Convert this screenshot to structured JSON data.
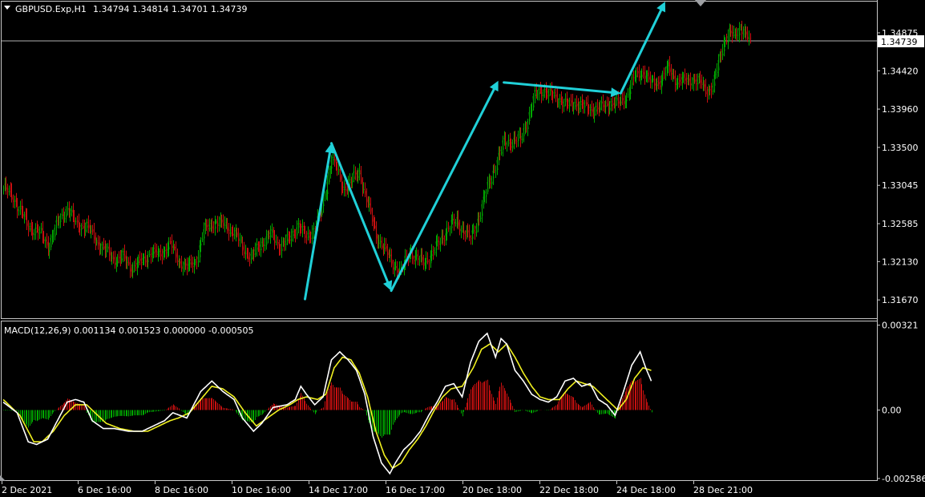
{
  "header": {
    "symbol": "GBPUSD.Exp,H1",
    "ohlc": "1.34794 1.34814 1.34701 1.34739"
  },
  "macd_header": {
    "label": "MACD(12,26,9) 0.001134 0.001523 0.000000 -0.000505"
  },
  "current_price": "1.34739",
  "colors": {
    "bull": "#00a800",
    "bear": "#c81010",
    "arrow": "#20d0d8",
    "macd_line": "#ffffff",
    "signal_line": "#f0f020",
    "grid_line": "#c0c0c0"
  },
  "chart_data": [
    {
      "type": "candlestick",
      "title": "GBPUSD.Exp,H1",
      "ylim": [
        1.3145,
        1.3525
      ],
      "y_ticks": [
        "1.34875",
        "1.34420",
        "1.33960",
        "1.33500",
        "1.33045",
        "1.32585",
        "1.32130",
        "1.31670"
      ],
      "x_ticks": [
        "2 Dec 2021",
        "6 Dec 16:00",
        "8 Dec 16:00",
        "10 Dec 16:00",
        "14 Dec 17:00",
        "16 Dec 17:00",
        "20 Dec 18:00",
        "22 Dec 18:00",
        "24 Dec 18:00",
        "28 Dec 21:00"
      ],
      "close_anchors": [
        [
          0,
          1.3302
        ],
        [
          6,
          1.3292
        ],
        [
          12,
          1.3275
        ],
        [
          18,
          1.3255
        ],
        [
          26,
          1.3248
        ],
        [
          32,
          1.3232
        ],
        [
          40,
          1.3262
        ],
        [
          46,
          1.3278
        ],
        [
          52,
          1.3258
        ],
        [
          60,
          1.3255
        ],
        [
          66,
          1.324
        ],
        [
          72,
          1.3228
        ],
        [
          80,
          1.3216
        ],
        [
          86,
          1.3218
        ],
        [
          92,
          1.3206
        ],
        [
          100,
          1.3214
        ],
        [
          106,
          1.3224
        ],
        [
          112,
          1.3221
        ],
        [
          120,
          1.3234
        ],
        [
          126,
          1.3214
        ],
        [
          132,
          1.3206
        ],
        [
          138,
          1.3212
        ],
        [
          144,
          1.325
        ],
        [
          152,
          1.3261
        ],
        [
          160,
          1.3256
        ],
        [
          166,
          1.3248
        ],
        [
          172,
          1.323
        ],
        [
          178,
          1.3218
        ],
        [
          186,
          1.3236
        ],
        [
          192,
          1.3246
        ],
        [
          198,
          1.3232
        ],
        [
          206,
          1.324
        ],
        [
          212,
          1.3258
        ],
        [
          218,
          1.324
        ],
        [
          224,
          1.3255
        ],
        [
          228,
          1.327
        ],
        [
          232,
          1.33
        ],
        [
          236,
          1.334
        ],
        [
          240,
          1.3322
        ],
        [
          244,
          1.33
        ],
        [
          250,
          1.331
        ],
        [
          256,
          1.332
        ],
        [
          262,
          1.3282
        ],
        [
          268,
          1.3245
        ],
        [
          274,
          1.3228
        ],
        [
          280,
          1.321
        ],
        [
          286,
          1.32
        ],
        [
          292,
          1.3226
        ],
        [
          296,
          1.3218
        ],
        [
          302,
          1.3212
        ],
        [
          308,
          1.3222
        ],
        [
          314,
          1.3238
        ],
        [
          320,
          1.3254
        ],
        [
          326,
          1.3262
        ],
        [
          330,
          1.3252
        ],
        [
          336,
          1.324
        ],
        [
          342,
          1.3268
        ],
        [
          348,
          1.3302
        ],
        [
          354,
          1.333
        ],
        [
          360,
          1.3356
        ],
        [
          366,
          1.3358
        ],
        [
          372,
          1.336
        ],
        [
          378,
          1.339
        ],
        [
          382,
          1.3412
        ],
        [
          388,
          1.342
        ],
        [
          394,
          1.3412
        ],
        [
          400,
          1.3408
        ],
        [
          406,
          1.34
        ],
        [
          412,
          1.3404
        ],
        [
          418,
          1.3398
        ],
        [
          424,
          1.3396
        ],
        [
          430,
          1.3398
        ],
        [
          436,
          1.3404
        ],
        [
          442,
          1.3402
        ],
        [
          448,
          1.3412
        ],
        [
          454,
          1.3435
        ],
        [
          460,
          1.3442
        ],
        [
          466,
          1.3426
        ],
        [
          472,
          1.343
        ],
        [
          478,
          1.3445
        ],
        [
          484,
          1.343
        ],
        [
          490,
          1.343
        ],
        [
          496,
          1.3432
        ],
        [
          502,
          1.3426
        ],
        [
          506,
          1.3418
        ],
        [
          510,
          1.3424
        ],
        [
          514,
          1.345
        ],
        [
          518,
          1.3478
        ],
        [
          522,
          1.3488
        ],
        [
          526,
          1.3482
        ],
        [
          530,
          1.3496
        ],
        [
          534,
          1.3486
        ],
        [
          537,
          1.3474
        ]
      ],
      "annotation_arrows": [
        [
          [
            217,
            1.3168
          ],
          [
            236,
            1.3355
          ]
        ],
        [
          [
            236,
            1.3355
          ],
          [
            279,
            1.3178
          ]
        ],
        [
          [
            279,
            1.3178
          ],
          [
            356,
            1.343
          ]
        ],
        [
          [
            360,
            1.3428
          ],
          [
            444,
            1.3415
          ]
        ],
        [
          [
            444,
            1.3415
          ],
          [
            476,
            1.3525
          ]
        ]
      ]
    },
    {
      "type": "macd",
      "title": "MACD(12,26,9) 0.001134 0.001523 0.000000 -0.000505",
      "ylim": [
        -0.00265,
        0.00335
      ],
      "y_ticks": [
        "0.00321",
        "0.00",
        "-0.002586"
      ],
      "macd_anchors": [
        [
          0,
          0.0003
        ],
        [
          10,
          -0.0001
        ],
        [
          18,
          -0.0012
        ],
        [
          24,
          -0.0013
        ],
        [
          32,
          -0.0011
        ],
        [
          40,
          -0.0003
        ],
        [
          46,
          0.0003
        ],
        [
          52,
          0.0004
        ],
        [
          58,
          0.0003
        ],
        [
          64,
          -0.0004
        ],
        [
          72,
          -0.0007
        ],
        [
          80,
          -0.0007
        ],
        [
          90,
          -0.0008
        ],
        [
          100,
          -0.0008
        ],
        [
          108,
          -0.0006
        ],
        [
          116,
          -0.0004
        ],
        [
          122,
          -0.0001
        ],
        [
          132,
          -0.0003
        ],
        [
          142,
          0.0007
        ],
        [
          150,
          0.0011
        ],
        [
          158,
          0.0007
        ],
        [
          166,
          0.0004
        ],
        [
          172,
          -0.0003
        ],
        [
          180,
          -0.0008
        ],
        [
          186,
          -0.0005
        ],
        [
          194,
          0.0001
        ],
        [
          204,
          0.0002
        ],
        [
          210,
          0.0004
        ],
        [
          214,
          0.0009
        ],
        [
          218,
          0.0006
        ],
        [
          224,
          0.0002
        ],
        [
          230,
          0.0005
        ],
        [
          236,
          0.0019
        ],
        [
          242,
          0.0022
        ],
        [
          248,
          0.0019
        ],
        [
          254,
          0.0015
        ],
        [
          260,
          0.0006
        ],
        [
          266,
          -0.001
        ],
        [
          272,
          -0.002
        ],
        [
          278,
          -0.0024
        ],
        [
          282,
          -0.002
        ],
        [
          288,
          -0.0015
        ],
        [
          294,
          -0.0012
        ],
        [
          300,
          -0.0008
        ],
        [
          306,
          -0.0002
        ],
        [
          312,
          0.0003
        ],
        [
          318,
          0.0009
        ],
        [
          324,
          0.001
        ],
        [
          330,
          0.0005
        ],
        [
          336,
          0.0018
        ],
        [
          342,
          0.0026
        ],
        [
          348,
          0.0029
        ],
        [
          354,
          0.002
        ],
        [
          358,
          0.0027
        ],
        [
          362,
          0.0025
        ],
        [
          368,
          0.0015
        ],
        [
          374,
          0.0011
        ],
        [
          380,
          0.0006
        ],
        [
          386,
          0.0004
        ],
        [
          392,
          0.0003
        ],
        [
          398,
          0.0005
        ],
        [
          404,
          0.0011
        ],
        [
          410,
          0.0012
        ],
        [
          416,
          0.0009
        ],
        [
          422,
          0.001
        ],
        [
          428,
          0.0004
        ],
        [
          434,
          0.0002
        ],
        [
          440,
          -0.0002
        ],
        [
          446,
          0.0007
        ],
        [
          452,
          0.0017
        ],
        [
          458,
          0.0022
        ],
        [
          462,
          0.0016
        ],
        [
          466,
          0.0011
        ]
      ],
      "signal_anchors": [
        [
          0,
          0.0004
        ],
        [
          12,
          -0.0002
        ],
        [
          22,
          -0.0012
        ],
        [
          28,
          -0.0012
        ],
        [
          36,
          -0.0008
        ],
        [
          44,
          -0.0002
        ],
        [
          52,
          0.0002
        ],
        [
          60,
          0.0002
        ],
        [
          66,
          -0.0001
        ],
        [
          74,
          -0.0005
        ],
        [
          84,
          -0.0007
        ],
        [
          94,
          -0.0008
        ],
        [
          104,
          -0.0008
        ],
        [
          112,
          -0.0006
        ],
        [
          120,
          -0.0004
        ],
        [
          126,
          -0.0003
        ],
        [
          134,
          -0.0001
        ],
        [
          142,
          0.0004
        ],
        [
          150,
          0.0009
        ],
        [
          158,
          0.0008
        ],
        [
          166,
          0.0005
        ],
        [
          174,
          -0.0001
        ],
        [
          182,
          -0.0006
        ],
        [
          190,
          -0.0003
        ],
        [
          198,
          0.0
        ],
        [
          206,
          0.0002
        ],
        [
          212,
          0.0004
        ],
        [
          218,
          0.0005
        ],
        [
          226,
          0.0004
        ],
        [
          232,
          0.0006
        ],
        [
          238,
          0.0016
        ],
        [
          244,
          0.002
        ],
        [
          250,
          0.0019
        ],
        [
          256,
          0.0014
        ],
        [
          262,
          0.0005
        ],
        [
          268,
          -0.0008
        ],
        [
          274,
          -0.0017
        ],
        [
          280,
          -0.0022
        ],
        [
          286,
          -0.002
        ],
        [
          292,
          -0.0015
        ],
        [
          298,
          -0.0011
        ],
        [
          304,
          -0.0006
        ],
        [
          310,
          0.0
        ],
        [
          316,
          0.0005
        ],
        [
          322,
          0.0008
        ],
        [
          330,
          0.0009
        ],
        [
          338,
          0.0016
        ],
        [
          344,
          0.0023
        ],
        [
          350,
          0.0025
        ],
        [
          356,
          0.0022
        ],
        [
          362,
          0.0025
        ],
        [
          368,
          0.002
        ],
        [
          374,
          0.0014
        ],
        [
          380,
          0.0009
        ],
        [
          386,
          0.0005
        ],
        [
          392,
          0.0004
        ],
        [
          400,
          0.0004
        ],
        [
          406,
          0.0008
        ],
        [
          412,
          0.0011
        ],
        [
          418,
          0.001
        ],
        [
          424,
          0.0009
        ],
        [
          430,
          0.0006
        ],
        [
          436,
          0.0003
        ],
        [
          442,
          0.0
        ],
        [
          448,
          0.0004
        ],
        [
          454,
          0.0012
        ],
        [
          460,
          0.0016
        ],
        [
          466,
          0.0015
        ]
      ]
    }
  ]
}
